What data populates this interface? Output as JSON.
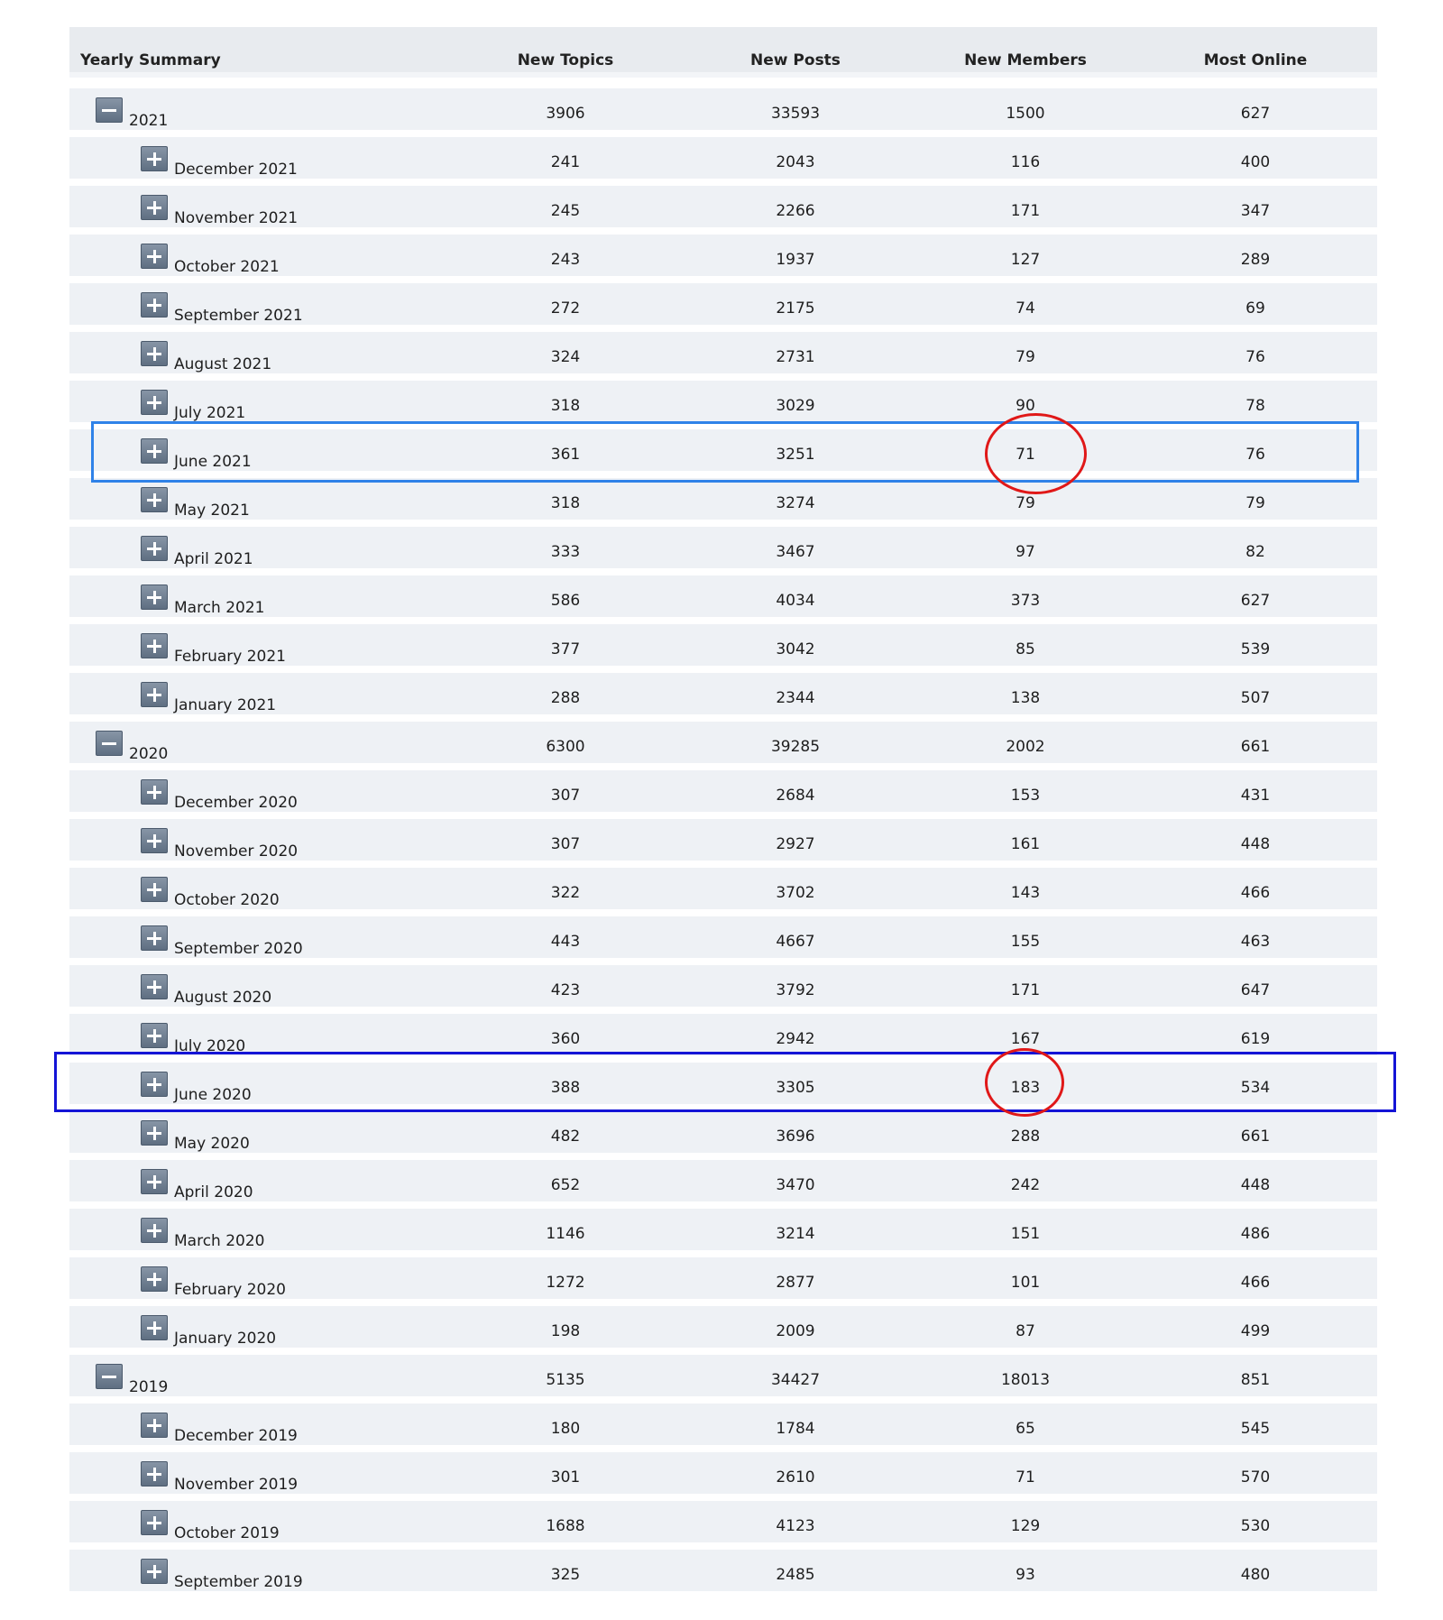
{
  "header": {
    "label": "Yearly Summary",
    "columns": [
      "New Topics",
      "New Posts",
      "New Members",
      "Most Online"
    ]
  },
  "rows": [
    {
      "type": "year",
      "label": "2021",
      "values": [
        "3906",
        "33593",
        "1500",
        "627"
      ]
    },
    {
      "type": "month",
      "label": "December 2021",
      "values": [
        "241",
        "2043",
        "116",
        "400"
      ]
    },
    {
      "type": "month",
      "label": "November 2021",
      "values": [
        "245",
        "2266",
        "171",
        "347"
      ]
    },
    {
      "type": "month",
      "label": "October 2021",
      "values": [
        "243",
        "1937",
        "127",
        "289"
      ]
    },
    {
      "type": "month",
      "label": "September 2021",
      "values": [
        "272",
        "2175",
        "74",
        "69"
      ]
    },
    {
      "type": "month",
      "label": "August 2021",
      "values": [
        "324",
        "2731",
        "79",
        "76"
      ]
    },
    {
      "type": "month",
      "label": "July 2021",
      "values": [
        "318",
        "3029",
        "90",
        "78"
      ]
    },
    {
      "type": "month",
      "label": "June 2021",
      "values": [
        "361",
        "3251",
        "71",
        "76"
      ]
    },
    {
      "type": "month",
      "label": "May 2021",
      "values": [
        "318",
        "3274",
        "79",
        "79"
      ]
    },
    {
      "type": "month",
      "label": "April 2021",
      "values": [
        "333",
        "3467",
        "97",
        "82"
      ]
    },
    {
      "type": "month",
      "label": "March 2021",
      "values": [
        "586",
        "4034",
        "373",
        "627"
      ]
    },
    {
      "type": "month",
      "label": "February 2021",
      "values": [
        "377",
        "3042",
        "85",
        "539"
      ]
    },
    {
      "type": "month",
      "label": "January 2021",
      "values": [
        "288",
        "2344",
        "138",
        "507"
      ]
    },
    {
      "type": "year",
      "label": "2020",
      "values": [
        "6300",
        "39285",
        "2002",
        "661"
      ]
    },
    {
      "type": "month",
      "label": "December 2020",
      "values": [
        "307",
        "2684",
        "153",
        "431"
      ]
    },
    {
      "type": "month",
      "label": "November 2020",
      "values": [
        "307",
        "2927",
        "161",
        "448"
      ]
    },
    {
      "type": "month",
      "label": "October 2020",
      "values": [
        "322",
        "3702",
        "143",
        "466"
      ]
    },
    {
      "type": "month",
      "label": "September 2020",
      "values": [
        "443",
        "4667",
        "155",
        "463"
      ]
    },
    {
      "type": "month",
      "label": "August 2020",
      "values": [
        "423",
        "3792",
        "171",
        "647"
      ]
    },
    {
      "type": "month",
      "label": "July 2020",
      "values": [
        "360",
        "2942",
        "167",
        "619"
      ]
    },
    {
      "type": "month",
      "label": "June 2020",
      "values": [
        "388",
        "3305",
        "183",
        "534"
      ]
    },
    {
      "type": "month",
      "label": "May 2020",
      "values": [
        "482",
        "3696",
        "288",
        "661"
      ]
    },
    {
      "type": "month",
      "label": "April 2020",
      "values": [
        "652",
        "3470",
        "242",
        "448"
      ]
    },
    {
      "type": "month",
      "label": "March 2020",
      "values": [
        "1146",
        "3214",
        "151",
        "486"
      ]
    },
    {
      "type": "month",
      "label": "February 2020",
      "values": [
        "1272",
        "2877",
        "101",
        "466"
      ]
    },
    {
      "type": "month",
      "label": "January 2020",
      "values": [
        "198",
        "2009",
        "87",
        "499"
      ]
    },
    {
      "type": "year",
      "label": "2019",
      "values": [
        "5135",
        "34427",
        "18013",
        "851"
      ]
    },
    {
      "type": "month",
      "label": "December 2019",
      "values": [
        "180",
        "1784",
        "65",
        "545"
      ]
    },
    {
      "type": "month",
      "label": "November 2019",
      "values": [
        "301",
        "2610",
        "71",
        "570"
      ]
    },
    {
      "type": "month",
      "label": "October 2019",
      "values": [
        "1688",
        "4123",
        "129",
        "530"
      ]
    },
    {
      "type": "month",
      "label": "September 2019",
      "values": [
        "325",
        "2485",
        "93",
        "480"
      ]
    }
  ],
  "icons": {
    "year_toggle": "collapse-minus-icon",
    "month_toggle": "expand-plus-icon"
  },
  "annotations": {
    "highlight_rows": [
      "June 2021",
      "June 2020"
    ],
    "circled_values": [
      "71",
      "183"
    ],
    "colors": {
      "box_2021": "#2f82e8",
      "box_2020": "#1414d6",
      "circle": "#e01818"
    }
  }
}
